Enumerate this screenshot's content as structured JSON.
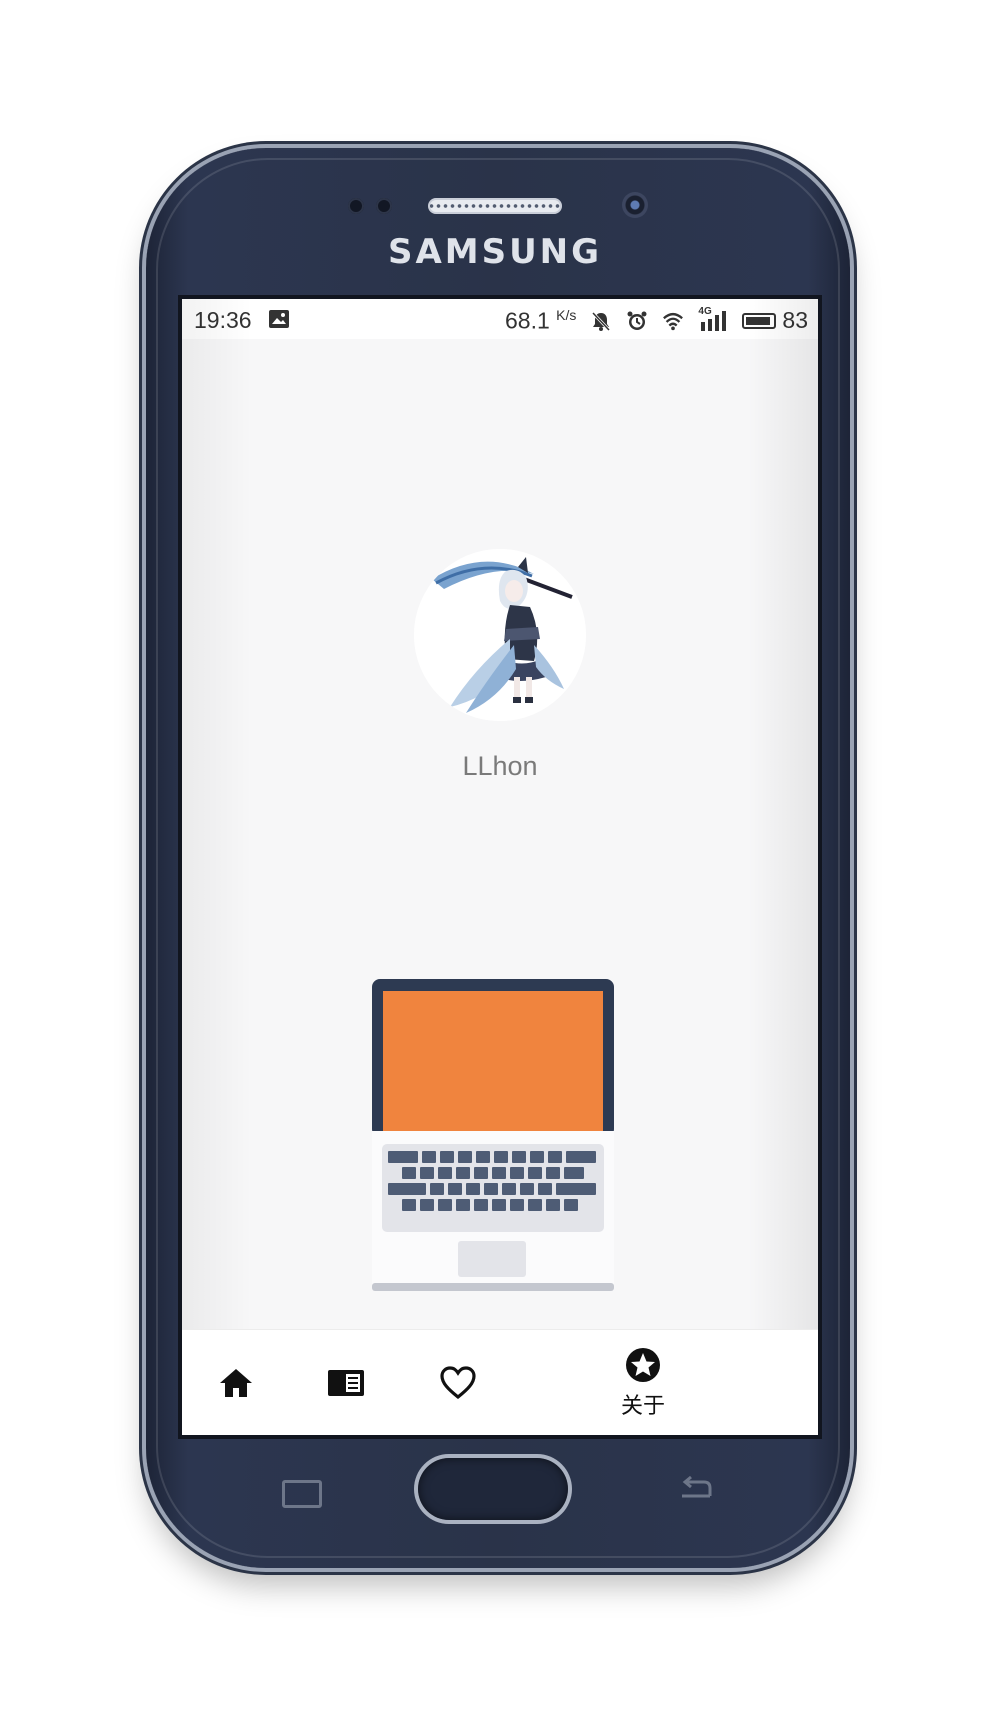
{
  "device": {
    "brand": "SAMSUNG"
  },
  "status_bar": {
    "time": "19:36",
    "network_speed_value": "68.1",
    "network_speed_unit": "K/s",
    "signal_type": "4G",
    "battery_level": "83",
    "icons": [
      "image-icon",
      "mute-bell-icon",
      "alarm-icon",
      "wifi-icon",
      "signal-icon",
      "battery-icon"
    ]
  },
  "profile": {
    "username": "LLhon"
  },
  "illustration": {
    "screen_color": "#F0843E",
    "frame_color": "#2D3A52"
  },
  "bottom_nav": {
    "items": [
      {
        "icon": "home-icon",
        "label": ""
      },
      {
        "icon": "news-icon",
        "label": ""
      },
      {
        "icon": "heart-icon",
        "label": ""
      },
      {
        "icon": "star-circle-icon",
        "label": "关于"
      }
    ]
  },
  "colors": {
    "phone_body": "#2A3349",
    "screen_background": "#F7F7F8",
    "text_muted": "#7A7A7A"
  }
}
